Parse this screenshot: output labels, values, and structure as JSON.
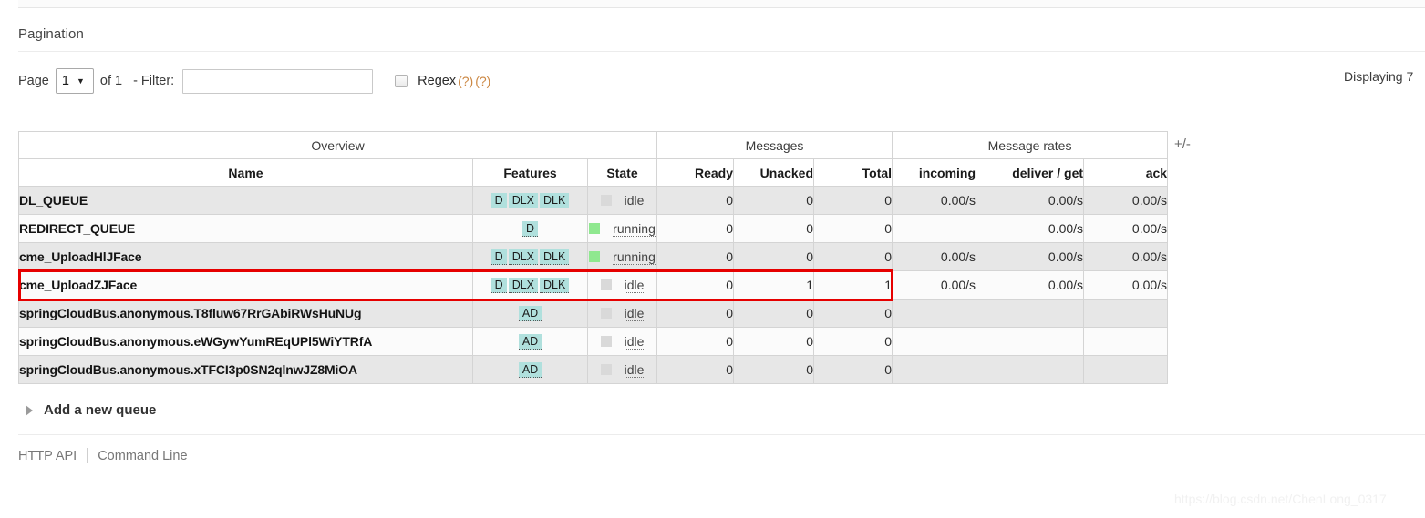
{
  "pagination": {
    "title": "Pagination",
    "page_label": "Page",
    "page_value": "1",
    "caret": "▼",
    "of_label": "of 1",
    "filter_label": "- Filter:",
    "filter_value": "",
    "filter_placeholder": "",
    "regex_label": "Regex",
    "help_1": "(?)",
    "help_2": "(?)",
    "displaying": "Displaying 7"
  },
  "table": {
    "group_headers": {
      "overview": "Overview",
      "messages": "Messages",
      "message_rates": "Message rates"
    },
    "columns": {
      "name": "Name",
      "features": "Features",
      "state": "State",
      "ready": "Ready",
      "unacked": "Unacked",
      "total": "Total",
      "incoming": "incoming",
      "deliver_get": "deliver / get",
      "ack": "ack"
    },
    "plus_minus": "+/-",
    "rows": [
      {
        "name": "DL_QUEUE",
        "features": [
          "D",
          "DLX",
          "DLK"
        ],
        "state": "idle",
        "state_color": "#d9d9d9",
        "ready": "0",
        "unacked": "0",
        "total": "0",
        "incoming": "0.00/s",
        "deliver_get": "0.00/s",
        "ack": "0.00/s"
      },
      {
        "name": "REDIRECT_QUEUE",
        "features": [
          "D"
        ],
        "state": "running",
        "state_color": "#8fe88f",
        "ready": "0",
        "unacked": "0",
        "total": "0",
        "incoming": "",
        "deliver_get": "0.00/s",
        "ack": "0.00/s"
      },
      {
        "name": "cme_UploadHlJFace",
        "features": [
          "D",
          "DLX",
          "DLK"
        ],
        "state": "running",
        "state_color": "#8fe88f",
        "ready": "0",
        "unacked": "0",
        "total": "0",
        "incoming": "0.00/s",
        "deliver_get": "0.00/s",
        "ack": "0.00/s"
      },
      {
        "name": "cme_UploadZJFace",
        "features": [
          "D",
          "DLX",
          "DLK"
        ],
        "state": "idle",
        "state_color": "#d9d9d9",
        "ready": "0",
        "unacked": "1",
        "total": "1",
        "incoming": "0.00/s",
        "deliver_get": "0.00/s",
        "ack": "0.00/s"
      },
      {
        "name": "springCloudBus.anonymous.T8fluw67RrGAbiRWsHuNUg",
        "features": [
          "AD"
        ],
        "state": "idle",
        "state_color": "#d9d9d9",
        "ready": "0",
        "unacked": "0",
        "total": "0",
        "incoming": "",
        "deliver_get": "",
        "ack": ""
      },
      {
        "name": "springCloudBus.anonymous.eWGywYumREqUPl5WiYTRfA",
        "features": [
          "AD"
        ],
        "state": "idle",
        "state_color": "#d9d9d9",
        "ready": "0",
        "unacked": "0",
        "total": "0",
        "incoming": "",
        "deliver_get": "",
        "ack": ""
      },
      {
        "name": "springCloudBus.anonymous.xTFCI3p0SN2qlnwJZ8MiOA",
        "features": [
          "AD"
        ],
        "state": "idle",
        "state_color": "#d9d9d9",
        "ready": "0",
        "unacked": "0",
        "total": "0",
        "incoming": "",
        "deliver_get": "",
        "ack": ""
      }
    ],
    "highlighted_row_index": 3,
    "highlight_color": "#e60000"
  },
  "add_queue": {
    "label": "Add a new queue"
  },
  "footer": {
    "http_api": "HTTP API",
    "command_line": "Command Line"
  },
  "watermark": "https://blog.csdn.net/ChenLong_0317"
}
